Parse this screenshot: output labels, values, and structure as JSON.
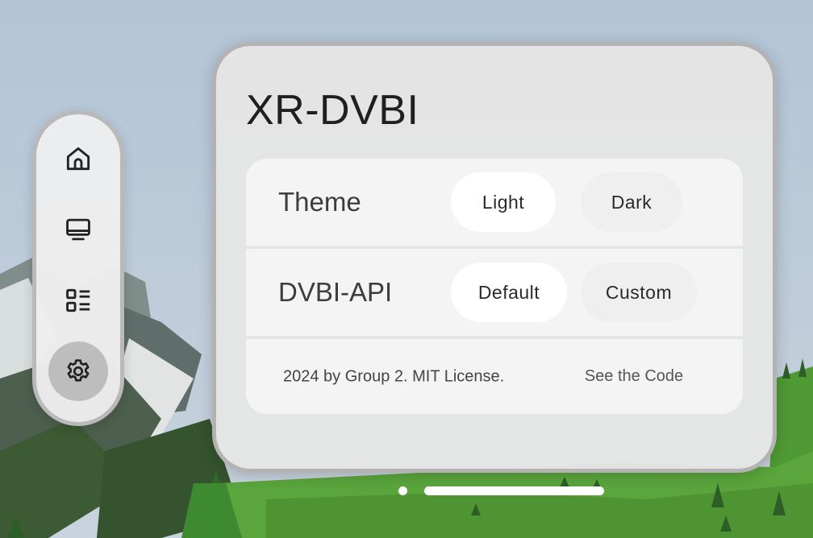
{
  "app": {
    "title": "XR-DVBI"
  },
  "nav": {
    "items": [
      {
        "icon": "home-icon",
        "active": false
      },
      {
        "icon": "tv-icon",
        "active": false
      },
      {
        "icon": "list-icon",
        "active": false
      },
      {
        "icon": "gear-icon",
        "active": true
      }
    ]
  },
  "settings": {
    "theme": {
      "label": "Theme",
      "options": [
        "Light",
        "Dark"
      ],
      "selected": "Light"
    },
    "api": {
      "label": "DVBI-API",
      "options": [
        "Default",
        "Custom"
      ],
      "selected": "Default"
    }
  },
  "footer": {
    "text": "2024 by Group 2. MIT License.",
    "link_label": "See the Code"
  },
  "colors": {
    "sky": "#b4c6d8",
    "grass": "#4f9a34",
    "mountain": "#6d7d7a",
    "panel": "#e5e5e5",
    "selected_pill": "#ffffff"
  }
}
